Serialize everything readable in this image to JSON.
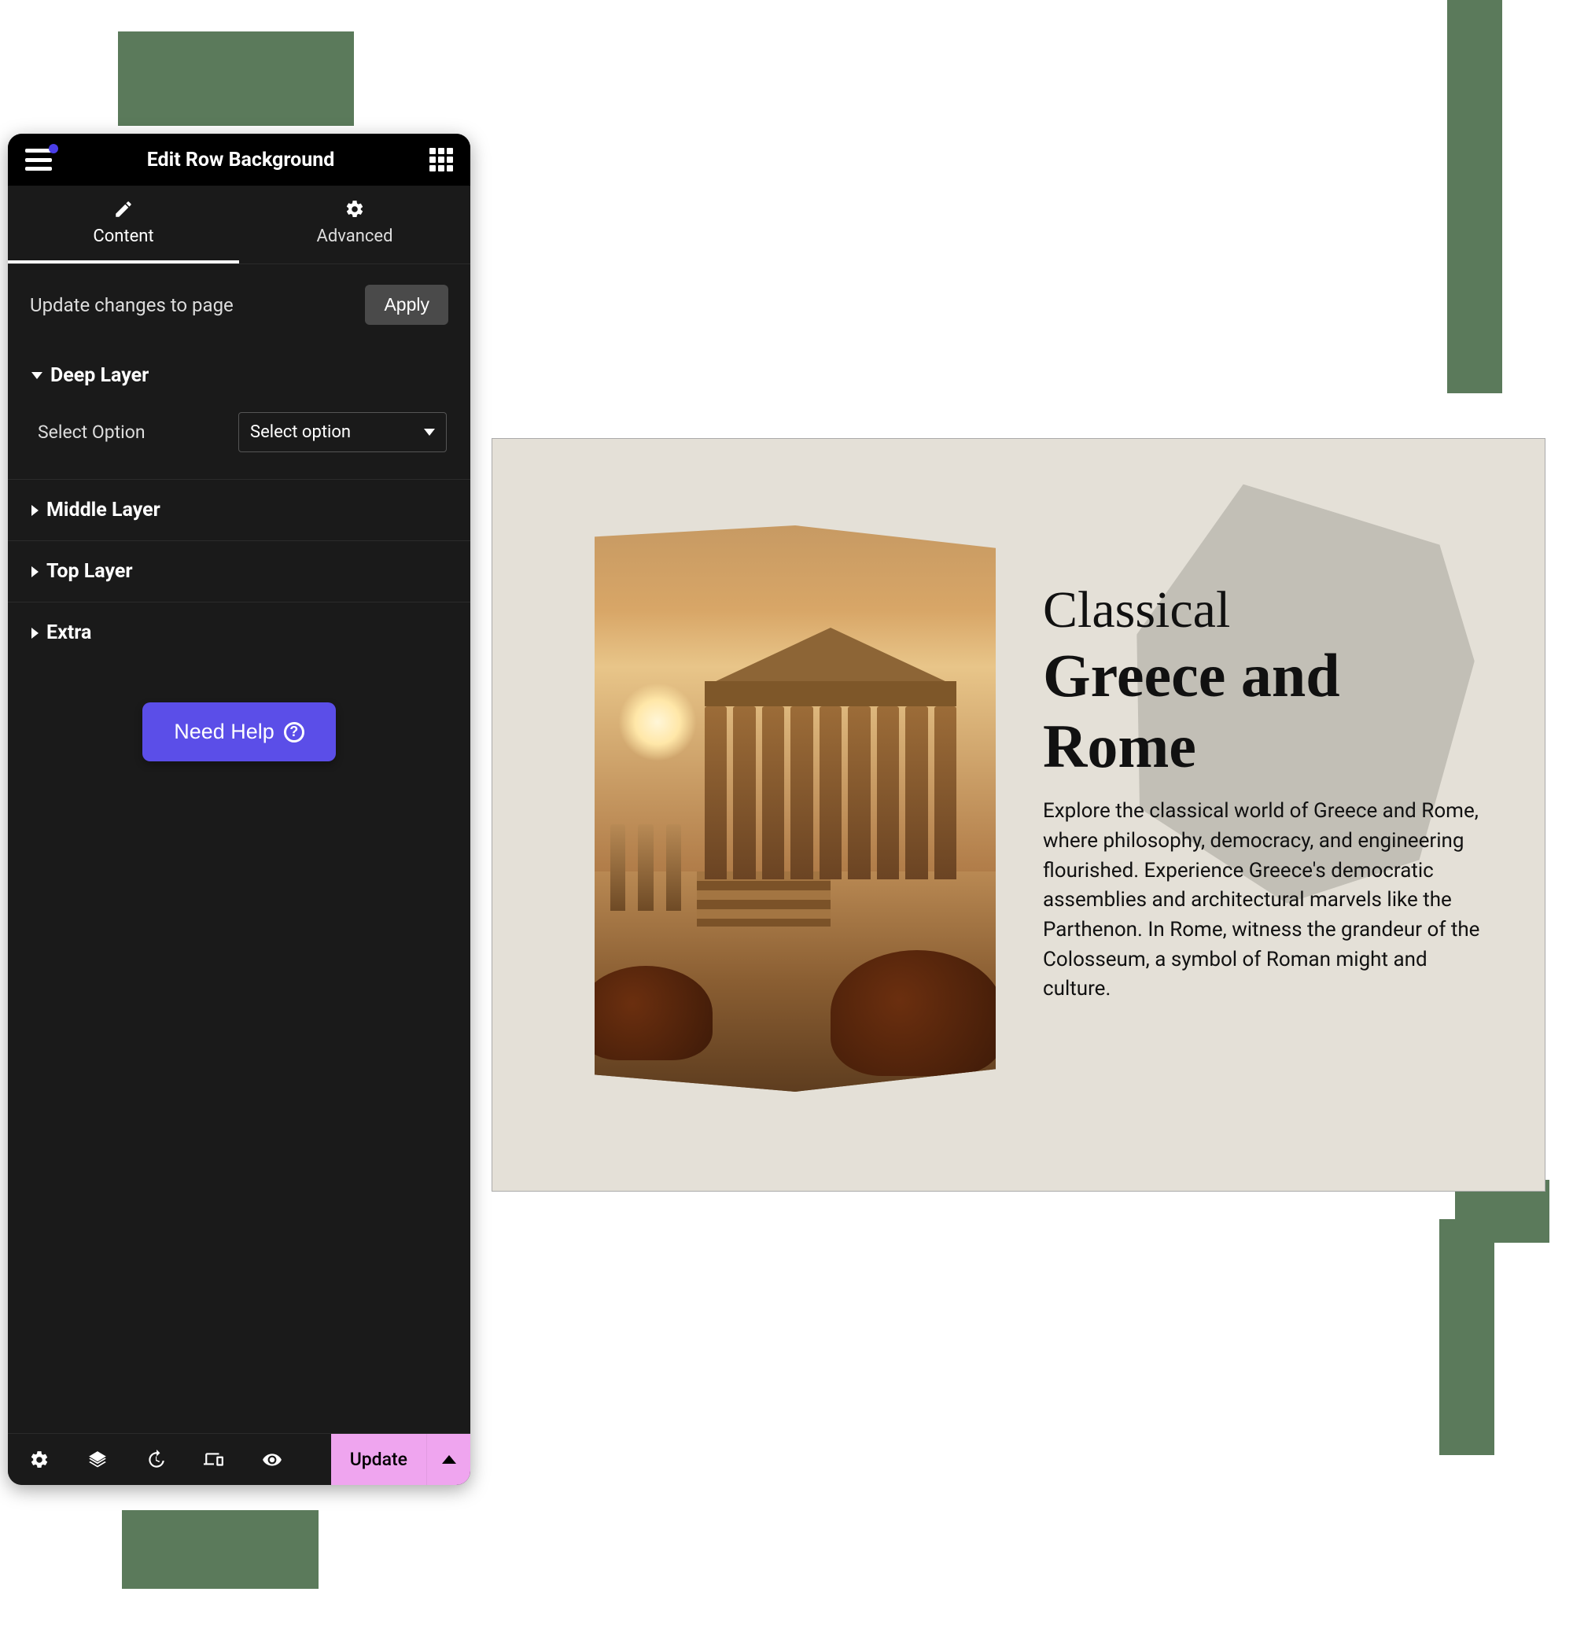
{
  "panel": {
    "title": "Edit Row Background",
    "tabs": {
      "content": "Content",
      "advanced": "Advanced",
      "active": "content"
    },
    "apply_row": {
      "label": "Update changes to page",
      "button": "Apply"
    },
    "sections": {
      "deep_layer": {
        "title": "Deep Layer",
        "expanded": true,
        "field_label": "Select Option",
        "select_placeholder": "Select option"
      },
      "middle_layer": {
        "title": "Middle Layer",
        "expanded": false
      },
      "top_layer": {
        "title": "Top Layer",
        "expanded": false
      },
      "extra": {
        "title": "Extra",
        "expanded": false
      }
    },
    "help_button": "Need Help",
    "footer": {
      "update": "Update"
    },
    "colors": {
      "primary_button": "#5b4ee8",
      "footer_accent": "#efa5ef",
      "notification_dot": "#4a3ee8"
    }
  },
  "preview": {
    "title_line1": "Classical",
    "title_line2": "Greece and",
    "title_line3": "Rome",
    "paragraph": "Explore the classical world of Greece and Rome, where philosophy, democracy, and engineering flourished. Experience Greece's democratic assemblies and architectural marvels like the Parthenon. In Rome, witness the grandeur of the Colosseum, a symbol of Roman might and culture.",
    "background_color": "#e4e0d7"
  }
}
